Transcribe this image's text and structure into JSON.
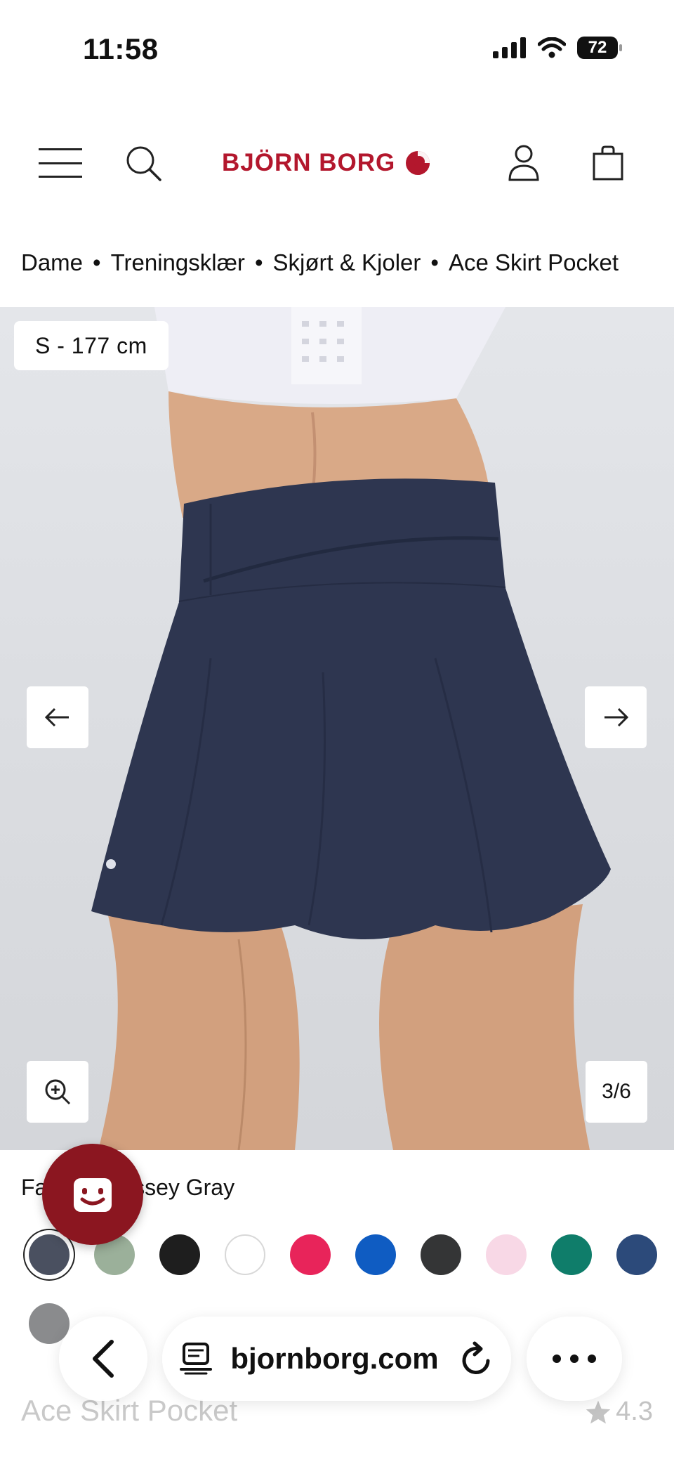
{
  "status_bar": {
    "time": "11:58",
    "battery": "72"
  },
  "header": {
    "brand": "BJÖRN BORG"
  },
  "breadcrumb": [
    "Dame",
    "Treningsklær",
    "Skjørt & Kjoler",
    "Ace Skirt Pocket"
  ],
  "gallery": {
    "size_label": "S - 177 cm",
    "counter": "3/6"
  },
  "color_label": "Farge: Odyssey Gray",
  "swatches": [
    {
      "color": "#4a5060",
      "selected": true
    },
    {
      "color": "#9bb09a"
    },
    {
      "color": "#1e1e1e"
    },
    {
      "color": "#ffffff"
    },
    {
      "color": "#e8245a"
    },
    {
      "color": "#0f5cc2"
    },
    {
      "color": "#343536"
    },
    {
      "color": "#f8d8e6"
    },
    {
      "color": "#0f7d6a"
    },
    {
      "color": "#2c4a7a"
    },
    {
      "color": "#8a8b8d"
    }
  ],
  "product": {
    "title": "Ace Skirt Pocket",
    "rating": "4.3"
  },
  "browser": {
    "url": "bjornborg.com"
  },
  "colors": {
    "brand": "#b3172d",
    "chat_fab": "#8b1620",
    "skirt": "#2e3650"
  }
}
